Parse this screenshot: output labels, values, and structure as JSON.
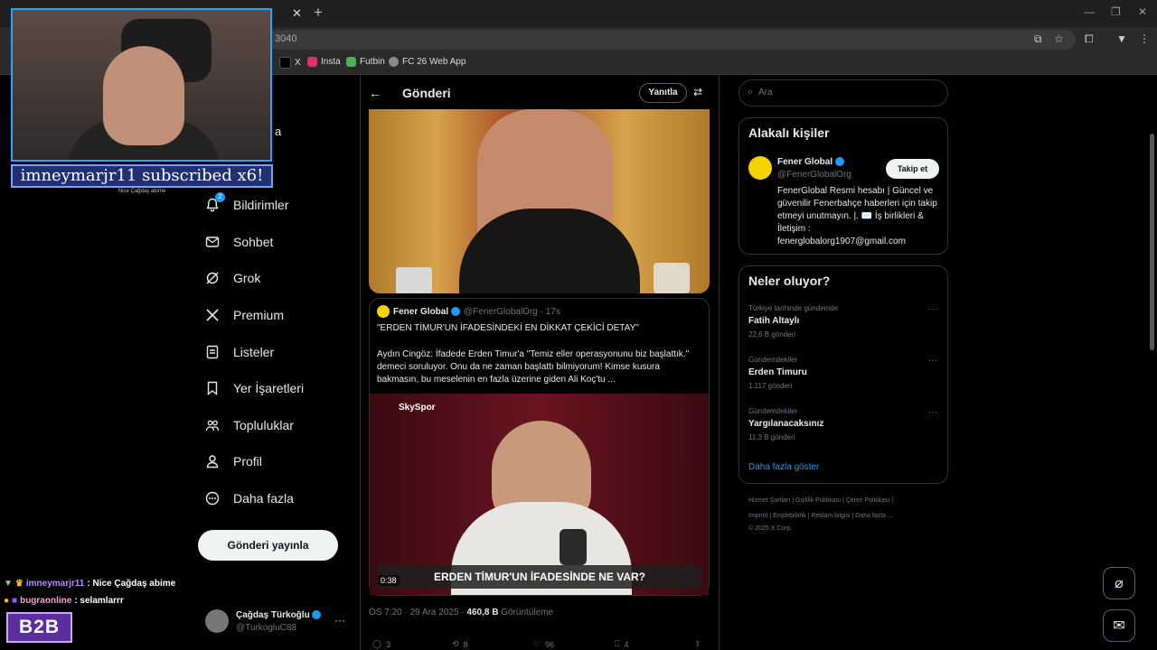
{
  "browser": {
    "url_fragment": "3040",
    "bookmarks": [
      {
        "label": "X",
        "color": "#000000"
      },
      {
        "label": "Insta",
        "color": "#e1306c"
      },
      {
        "label": "Futbin",
        "color": "#4caf50"
      },
      {
        "label": "FC 26 Web App",
        "color": "#888888"
      }
    ]
  },
  "stream": {
    "sub_banner": "imneymarjr11 subscribed x6!",
    "sub_small": "Nice Çağdaş abime",
    "chat": [
      {
        "user": "imneymarjr11",
        "message": ": Nice Çağdaş abime"
      },
      {
        "user": "bugraonline",
        "message": ": selamlarrr"
      }
    ],
    "logo": "B2B"
  },
  "nav": {
    "partial_label": "a",
    "items": [
      {
        "label": "Bildirimler",
        "icon": "bell-icon",
        "badge": "2"
      },
      {
        "label": "Sohbet",
        "icon": "mail-icon"
      },
      {
        "label": "Grok",
        "icon": "grok-icon"
      },
      {
        "label": "Premium",
        "icon": "x-logo-icon"
      },
      {
        "label": "Listeler",
        "icon": "list-icon"
      },
      {
        "label": "Yer İşaretleri",
        "icon": "bookmark-icon"
      },
      {
        "label": "Topluluklar",
        "icon": "communities-icon"
      },
      {
        "label": "Profil",
        "icon": "profile-icon"
      },
      {
        "label": "Daha fazla",
        "icon": "more-circle-icon"
      }
    ],
    "post_button": "Gönderi yayınla",
    "account": {
      "name": "Çağdaş Türkoğlu",
      "handle": "@TurkogluC88",
      "more": "···"
    }
  },
  "post": {
    "header_title": "Gönderi",
    "reply_button": "Yanıtla",
    "quote": {
      "name": "Fener Global",
      "handle": "@FenerGlobalOrg · 17s",
      "title": "\"ERDEN TİMUR'UN İFADESİNDEKİ EN DİKKAT ÇEKİCİ DETAY\"",
      "body": "Aydın Cingöz: İfadede Erden Timur'a \"Temiz eller operasyonunu biz başlattık.\" demeci soruluyor. Onu da ne zaman başlattı bilmiyorum! Kimse kusura bakmasın, bu meselenin en fazla üzerine giden Ali Koç'tu ...",
      "video_brand": "SkySpor",
      "video_caption": "ERDEN TİMUR'UN İFADESİNDE NE VAR?",
      "video_time": "0:38"
    },
    "meta_time": "ÖS 7:20 · 29 Ara 2025 · ",
    "meta_views": "460,8 B",
    "meta_views_label": " Görüntüleme",
    "actions": [
      {
        "icon": "reply-icon",
        "count": "3"
      },
      {
        "icon": "retweet-icon",
        "count": "8"
      },
      {
        "icon": "like-icon",
        "count": "96"
      },
      {
        "icon": "bookmark-icon",
        "count": "4"
      },
      {
        "icon": "share-icon",
        "count": ""
      }
    ]
  },
  "sidebar": {
    "search_placeholder": "Ara",
    "related": {
      "title": "Alakalı kişiler",
      "name": "Fener Global",
      "handle": "@FenerGlobalOrg",
      "follow_button": "Takip et",
      "bio": "FenerGlobal Resmi hesabı | Güncel ve güvenilir Fenerbahçe haberleri için takip etmeyi unutmayın. |. ✉️ İş birlikleri & İletişim : fenerglobalorg1907@gmail.com"
    },
    "trends": {
      "title": "Neler oluyor?",
      "items": [
        {
          "category": "Türkiye tarihinde gündemde",
          "name": "Fatih Altaylı",
          "count": "22,6 B gönderi"
        },
        {
          "category": "Gündemdekiler",
          "name": "Erden Timuru",
          "count": "1.117 gönderi"
        },
        {
          "category": "Gündemdekiler",
          "name": "Yargılanacaksınız",
          "count": "11,3 B gönderi"
        }
      ],
      "show_more": "Daha fazla göster"
    },
    "footer_line1": "Hizmet Şartları  |  Gizlilik Politikası  |  Çerez Politikası  |",
    "footer_line2": "Imprint  |  Erişilebilirlik  |  Reklam bilgisi  |  Daha fazla ...",
    "footer_line3": "© 2025 X Corp."
  },
  "colors": {
    "accent": "#1d9bf0",
    "background": "#000000",
    "verified": "#1d9bf0"
  }
}
